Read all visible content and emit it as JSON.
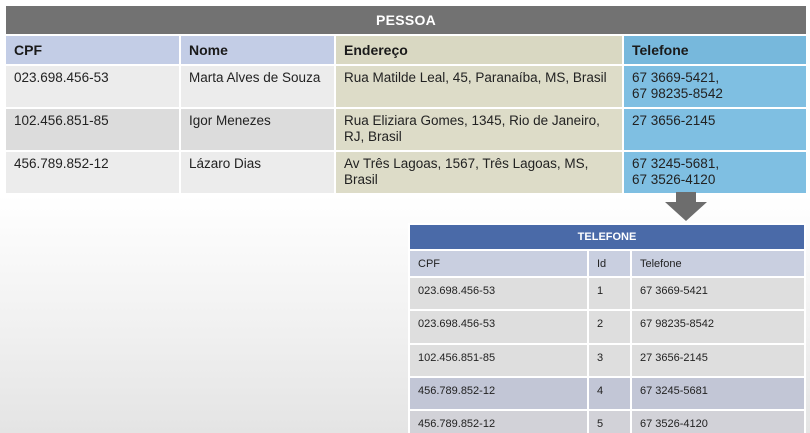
{
  "pessoa": {
    "title": "PESSOA",
    "headers": [
      "CPF",
      "Nome",
      "Endereço",
      "Telefone"
    ],
    "rows": [
      {
        "cpf": "023.698.456-53",
        "nome": "Marta Alves de Souza",
        "endereco": "Rua Matilde Leal, 45, Paranaíba, MS, Brasil",
        "telefone": [
          "67 3669-5421,",
          "67 98235-8542"
        ]
      },
      {
        "cpf": "102.456.851-85",
        "nome": "Igor Menezes",
        "endereco": "Rua Eliziara Gomes, 1345, Rio de Janeiro, RJ, Brasil",
        "telefone": [
          "27 3656-2145"
        ]
      },
      {
        "cpf": "456.789.852-12",
        "nome": "Lázaro Dias",
        "endereco": "Av Três Lagoas, 1567, Três Lagoas, MS, Brasil",
        "telefone": [
          "67 3245-5681,",
          "67 3526-4120"
        ]
      }
    ]
  },
  "arrow": {
    "icon": "down-arrow-icon",
    "color": "#6d6d6d"
  },
  "telefone": {
    "title": "TELEFONE",
    "headers": [
      "CPF",
      "Id",
      "Telefone"
    ],
    "rows": [
      {
        "cpf": "023.698.456-53",
        "id": "1",
        "telefone": "67 3669-5421"
      },
      {
        "cpf": "023.698.456-53",
        "id": "2",
        "telefone": "67 98235-8542"
      },
      {
        "cpf": "102.456.851-85",
        "id": "3",
        "telefone": "27 3656-2145"
      },
      {
        "cpf": "456.789.852-12",
        "id": "4",
        "telefone": "67 3245-5681"
      },
      {
        "cpf": "456.789.852-12",
        "id": "5",
        "telefone": "67 3526-4120"
      }
    ]
  },
  "colors": {
    "pessoa_title_bg": "#727272",
    "pessoa_header_cpf_nome": "#c3cde6",
    "pessoa_header_endereco": "#d9d8c2",
    "pessoa_header_telefone": "#77b8dc",
    "telefone_title_bg": "#4a6aa8"
  }
}
